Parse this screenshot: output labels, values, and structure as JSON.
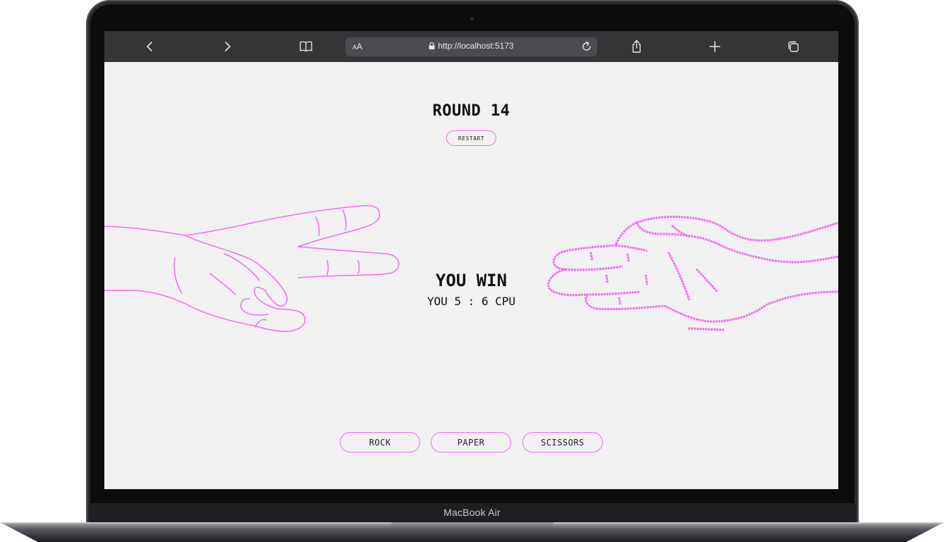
{
  "device": {
    "brand_label": "MacBook Air"
  },
  "browser": {
    "back_icon": "chevron-left-icon",
    "forward_icon": "chevron-right-icon",
    "bookmarks_icon": "book-icon",
    "text_size_label": "AA",
    "url": "http://localhost:5173",
    "lock_icon": "lock-icon",
    "reload_icon": "reload-icon",
    "share_icon": "share-icon",
    "new_tab_icon": "plus-icon",
    "tabs_icon": "tabs-icon"
  },
  "game": {
    "round_label": "ROUND 14",
    "restart_label": "RESTART",
    "result_label": "YOU WIN",
    "score_label": "YOU 5 : 6 CPU",
    "player_hand": "scissors",
    "cpu_hand": "paper",
    "choices": [
      {
        "label": "ROCK"
      },
      {
        "label": "PAPER"
      },
      {
        "label": "SCISSORS"
      }
    ]
  },
  "colors": {
    "accent": "#f06bf1",
    "page_background": "#f2f1f1",
    "toolbar_background": "#333537",
    "text": "#111111"
  }
}
